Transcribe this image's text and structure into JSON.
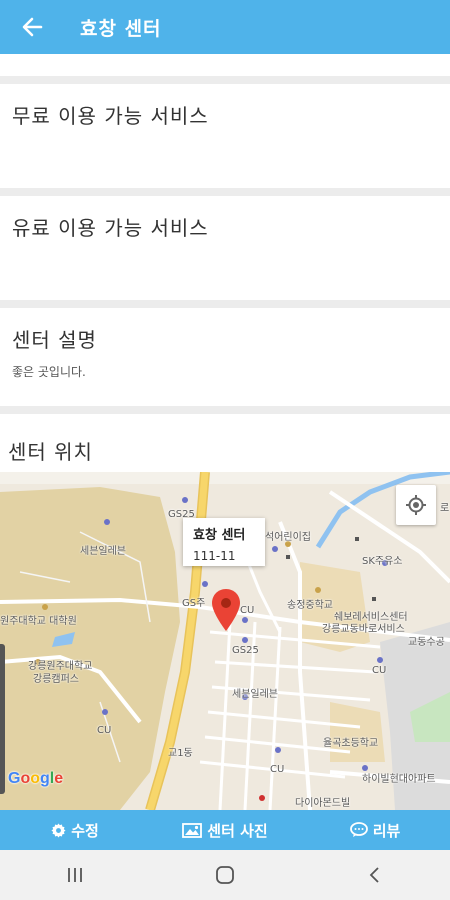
{
  "header": {
    "title": "효창 센터",
    "back_icon": "arrow-left-icon"
  },
  "sections": {
    "free_services": {
      "title": "무료 이용 가능 서비스"
    },
    "paid_services": {
      "title": "유료 이용 가능 서비스"
    },
    "description": {
      "title": "센터 설명",
      "text": "좋은 곳입니다."
    },
    "location": {
      "title": "센터 위치"
    }
  },
  "map": {
    "info_window": {
      "name": "효창 센터",
      "address": "111-11"
    },
    "labels": [
      "GS25",
      "세븐일레븐",
      "GS주",
      "CU",
      "석어린이집",
      "SK주유소",
      "송정중학교",
      "쉐보레서비스센터",
      "강릉교동바로서비스",
      "교동수공",
      "원주대학교 대학원",
      "강릉원주대학교",
      "강릉캠퍼스",
      "GS25",
      "CU",
      "세븐일레븐",
      "율곡초등학교",
      "CU",
      "CU",
      "하이빌현대아파트",
      "교1동",
      "로",
      "다이아몬드빌"
    ],
    "attribution": "Google",
    "colors": {
      "land": "#efe9de",
      "campus": "#e2d2a4",
      "road": "#ffffff",
      "highway": "#f7d66b",
      "river": "#8fc2f0",
      "marker": "#ea4335"
    }
  },
  "tabs": [
    {
      "label": "수정",
      "icon": "gear-icon"
    },
    {
      "label": "센터 사진",
      "icon": "image-icon"
    },
    {
      "label": "리뷰",
      "icon": "chat-icon"
    }
  ],
  "nav": {
    "recent": "recent-apps-icon",
    "home": "home-icon",
    "back": "nav-back-icon"
  }
}
